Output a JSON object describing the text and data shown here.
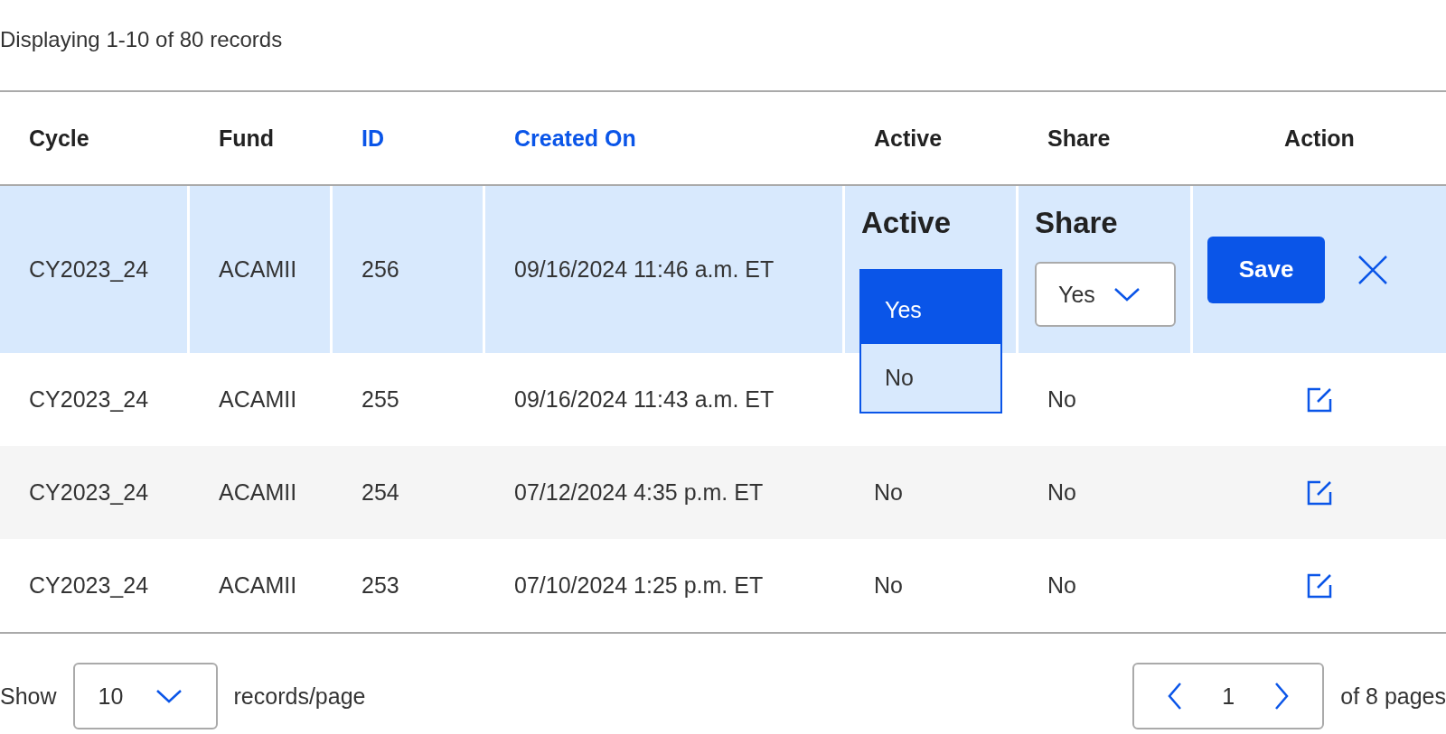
{
  "summary": "Displaying 1-10 of 80 records",
  "columns": [
    {
      "label": "Cycle",
      "sortable": false
    },
    {
      "label": "Fund",
      "sortable": false
    },
    {
      "label": "ID",
      "sortable": true
    },
    {
      "label": "Created On",
      "sortable": true
    },
    {
      "label": "Active",
      "sortable": false
    },
    {
      "label": "Share",
      "sortable": false
    },
    {
      "label": "Action",
      "sortable": false
    }
  ],
  "rows": [
    {
      "cycle": "CY2023_24",
      "fund": "ACAMII",
      "id": "256",
      "created_on": "09/16/2024 11:46 a.m. ET",
      "editing": true,
      "active_label": "Active",
      "active_options": [
        {
          "label": "Yes",
          "selected": true
        },
        {
          "label": "No",
          "selected": false
        }
      ],
      "share_label": "Share",
      "share_value": "Yes",
      "save": "Save"
    },
    {
      "cycle": "CY2023_24",
      "fund": "ACAMII",
      "id": "255",
      "created_on": "09/16/2024 11:43 a.m. ET",
      "editing": false,
      "share": "No"
    },
    {
      "cycle": "CY2023_24",
      "fund": "ACAMII",
      "id": "254",
      "created_on": "07/12/2024 4:35 p.m. ET",
      "editing": false,
      "active": "No",
      "share": "No"
    },
    {
      "cycle": "CY2023_24",
      "fund": "ACAMII",
      "id": "253",
      "created_on": "07/10/2024 1:25 p.m. ET",
      "editing": false,
      "active": "No",
      "share": "No"
    }
  ],
  "footer": {
    "show_label": "Show",
    "page_size": "10",
    "per_page_label": "records/page",
    "page": "1",
    "pages_label": "of 8 pages"
  }
}
